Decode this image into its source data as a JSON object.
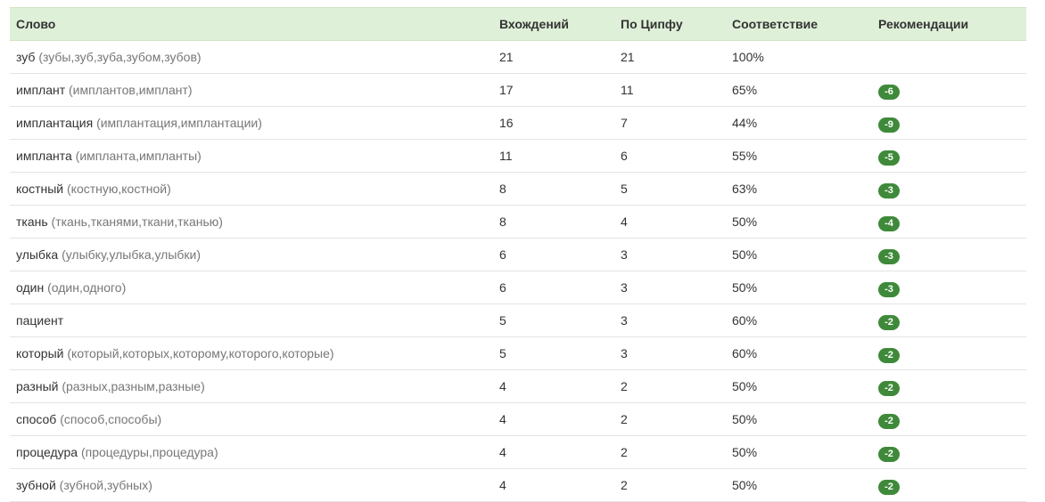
{
  "headers": {
    "word": "Слово",
    "occurrences": "Вхождений",
    "zipf": "По Ципфу",
    "match": "Соответствие",
    "recommendations": "Рекомендации"
  },
  "colors": {
    "header_bg": "#dff0d8",
    "badge_bg": "#3f8a3a",
    "forms_text": "#777777"
  },
  "rows": [
    {
      "word": "зуб",
      "forms": "(зубы,зуб,зуба,зубом,зубов)",
      "occurrences": "21",
      "zipf": "21",
      "match": "100%",
      "rec": ""
    },
    {
      "word": "имплант",
      "forms": "(имплантов,имплант)",
      "occurrences": "17",
      "zipf": "11",
      "match": "65%",
      "rec": "-6"
    },
    {
      "word": "имплантация",
      "forms": "(имплантация,имплантации)",
      "occurrences": "16",
      "zipf": "7",
      "match": "44%",
      "rec": "-9"
    },
    {
      "word": "импланта",
      "forms": "(импланта,импланты)",
      "occurrences": "11",
      "zipf": "6",
      "match": "55%",
      "rec": "-5"
    },
    {
      "word": "костный",
      "forms": "(костную,костной)",
      "occurrences": "8",
      "zipf": "5",
      "match": "63%",
      "rec": "-3"
    },
    {
      "word": "ткань",
      "forms": "(ткань,тканями,ткани,тканью)",
      "occurrences": "8",
      "zipf": "4",
      "match": "50%",
      "rec": "-4"
    },
    {
      "word": "улыбка",
      "forms": "(улыбку,улыбка,улыбки)",
      "occurrences": "6",
      "zipf": "3",
      "match": "50%",
      "rec": "-3"
    },
    {
      "word": "один",
      "forms": "(один,одного)",
      "occurrences": "6",
      "zipf": "3",
      "match": "50%",
      "rec": "-3"
    },
    {
      "word": "пациент",
      "forms": "",
      "occurrences": "5",
      "zipf": "3",
      "match": "60%",
      "rec": "-2"
    },
    {
      "word": "который",
      "forms": "(который,которых,которому,которого,которые)",
      "occurrences": "5",
      "zipf": "3",
      "match": "60%",
      "rec": "-2"
    },
    {
      "word": "разный",
      "forms": "(разных,разным,разные)",
      "occurrences": "4",
      "zipf": "2",
      "match": "50%",
      "rec": "-2"
    },
    {
      "word": "способ",
      "forms": "(способ,способы)",
      "occurrences": "4",
      "zipf": "2",
      "match": "50%",
      "rec": "-2"
    },
    {
      "word": "процедура",
      "forms": "(процедуры,процедура)",
      "occurrences": "4",
      "zipf": "2",
      "match": "50%",
      "rec": "-2"
    },
    {
      "word": "зубной",
      "forms": "(зубной,зубных)",
      "occurrences": "4",
      "zipf": "2",
      "match": "50%",
      "rec": "-2"
    }
  ]
}
